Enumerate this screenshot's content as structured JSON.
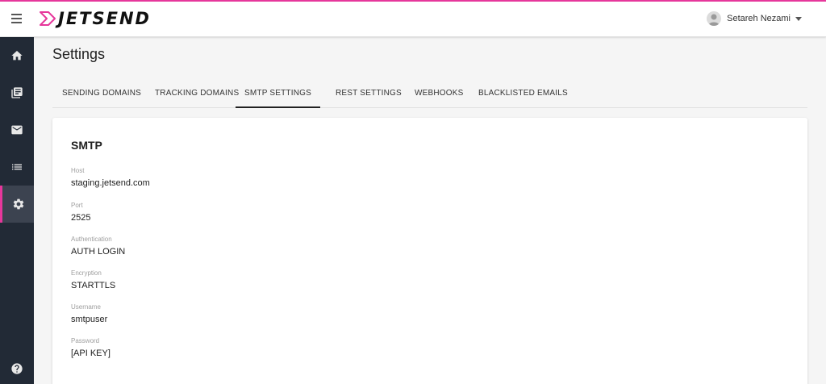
{
  "header": {
    "logo_text": "JETSEND",
    "user_name": "Setareh Nezami",
    "accent_color": "#e6379b"
  },
  "sidebar": {
    "background": "#222a36",
    "items": [
      {
        "icon": "home-icon"
      },
      {
        "icon": "library-books-icon"
      },
      {
        "icon": "mail-icon"
      },
      {
        "icon": "list-icon"
      },
      {
        "icon": "gear-icon",
        "active": true
      },
      {
        "icon": "help-icon"
      }
    ]
  },
  "page": {
    "title": "Settings"
  },
  "tabs": [
    {
      "label": "SENDING DOMAINS"
    },
    {
      "label": "TRACKING DOMAINS"
    },
    {
      "label": "SMTP SETTINGS",
      "active": true
    },
    {
      "label": "REST SETTINGS"
    },
    {
      "label": "WEBHOOKS"
    },
    {
      "label": "BLACKLISTED EMAILS"
    }
  ],
  "smtp": {
    "title": "SMTP",
    "fields": [
      {
        "label": "Host",
        "value": "staging.jetsend.com"
      },
      {
        "label": "Port",
        "value": "2525"
      },
      {
        "label": "Authentication",
        "value": "AUTH LOGIN"
      },
      {
        "label": "Encryption",
        "value": "STARTTLS"
      },
      {
        "label": "Username",
        "value": "smtpuser"
      },
      {
        "label": "Password",
        "value": "[API KEY]"
      }
    ]
  }
}
